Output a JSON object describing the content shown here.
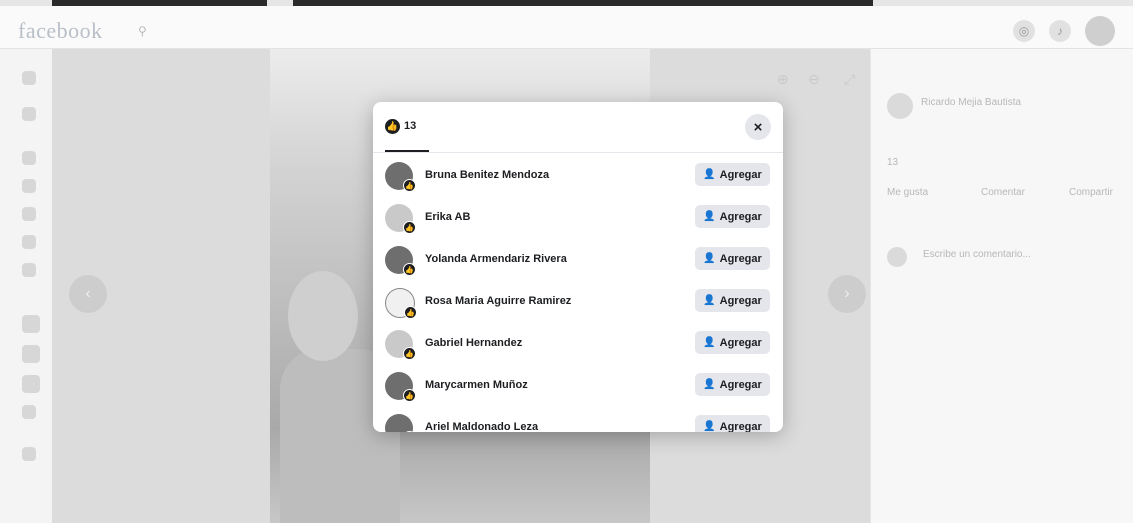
{
  "topbar": {
    "logo": "facebook"
  },
  "modal": {
    "reaction_count": "13",
    "close_label": "×",
    "add_label": "Agregar",
    "people": [
      {
        "name": "Bruna Benitez Mendoza"
      },
      {
        "name": "Erika AB"
      },
      {
        "name": "Yolanda Armendariz Rivera"
      },
      {
        "name": "Rosa Maria Aguirre Ramirez"
      },
      {
        "name": "Gabriel Hernandez"
      },
      {
        "name": "Marycarmen Muñoz"
      },
      {
        "name": "Ariel Maldonado Leza"
      }
    ]
  },
  "right_panel": {
    "author": "Ricardo Mejia Bautista",
    "reaction_count": "13",
    "like": "Me gusta",
    "comment": "Comentar",
    "share": "Compartir",
    "comment_placeholder": "Escribe un comentario..."
  },
  "icons": {
    "search": "search-icon",
    "close": "close-icon",
    "add_friend": "add-friend-icon",
    "reaction": "like-reaction-icon"
  }
}
